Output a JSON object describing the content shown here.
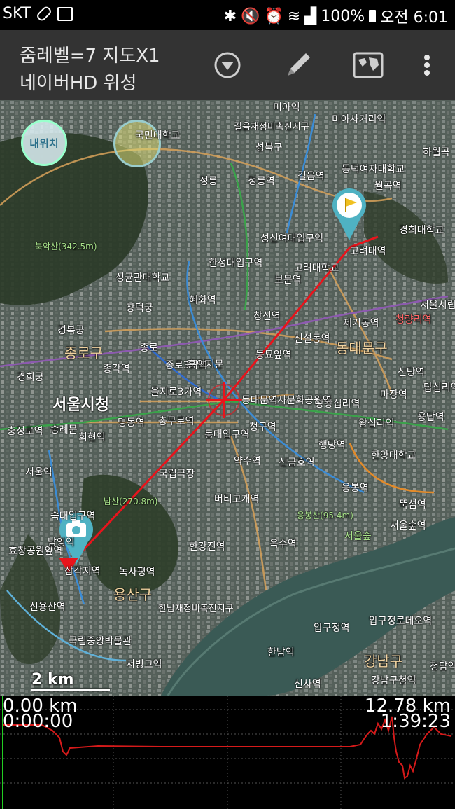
{
  "status": {
    "carrier": "SKT",
    "battery": "100%",
    "time": "오전 6:01"
  },
  "appbar": {
    "line1": "줌레벨=7 지도X1",
    "line2": "네이버HD 위성"
  },
  "map": {
    "my_location_label": "내위치",
    "scale_label": "2 km",
    "labels": [
      "서울시청",
      "종로구",
      "동대문구",
      "용산구",
      "강남구",
      "성북구",
      "혜화역",
      "동묘앞역",
      "신설동역",
      "고려대학교",
      "경희대학교",
      "청량리역",
      "왕십리역",
      "약수역",
      "옥수역",
      "한강진역",
      "녹사평역",
      "숙대입구역",
      "서울역",
      "회현역",
      "명동역",
      "충무로역",
      "을지로3가역",
      "동대입구역",
      "신당역",
      "상왕십리역",
      "행당역",
      "마장역",
      "답십리역",
      "한양대학교",
      "응봉역",
      "뚝섬역",
      "서울숲역",
      "압구정역",
      "신사역",
      "강남구청역",
      "한남역",
      "서빙고역",
      "신용산역",
      "효창공원앞역",
      "국립중앙박물관",
      "정릉",
      "정릉역",
      "성신여대입구역",
      "한성대입구역",
      "길음역",
      "월곡역",
      "보문역",
      "창신역",
      "종로3가역",
      "종각역",
      "동덕여자대학교",
      "고려대역",
      "북악산(342.5m)",
      "남산(270.8m)",
      "응봉산(95.4m)",
      "국민대학교",
      "성균관대학교",
      "창덕궁",
      "경복궁",
      "국립극장",
      "버티고개역",
      "청구역",
      "신금호역",
      "동대문역사문화공원역",
      "삼각지역",
      "남영역",
      "제기동역",
      "서울시립대",
      "하월곡",
      "미아사거리역",
      "길음재정비촉진지구",
      "한남재정비촉진지구",
      "압구정로데오역",
      "청담역",
      "용답역",
      "서울숲",
      "숭례문",
      "충정로역",
      "경희궁",
      "흥인지문",
      "미아역",
      "종로"
    ]
  },
  "profile": {
    "start_distance": "0.00 km",
    "start_time": "0:00:00",
    "end_distance": "12.78 km",
    "end_time": "1:39:23"
  },
  "colors": {
    "route": "#e8141c",
    "appbar": "#333333",
    "profile_line": "#d61a1a",
    "grid": "#555555"
  }
}
